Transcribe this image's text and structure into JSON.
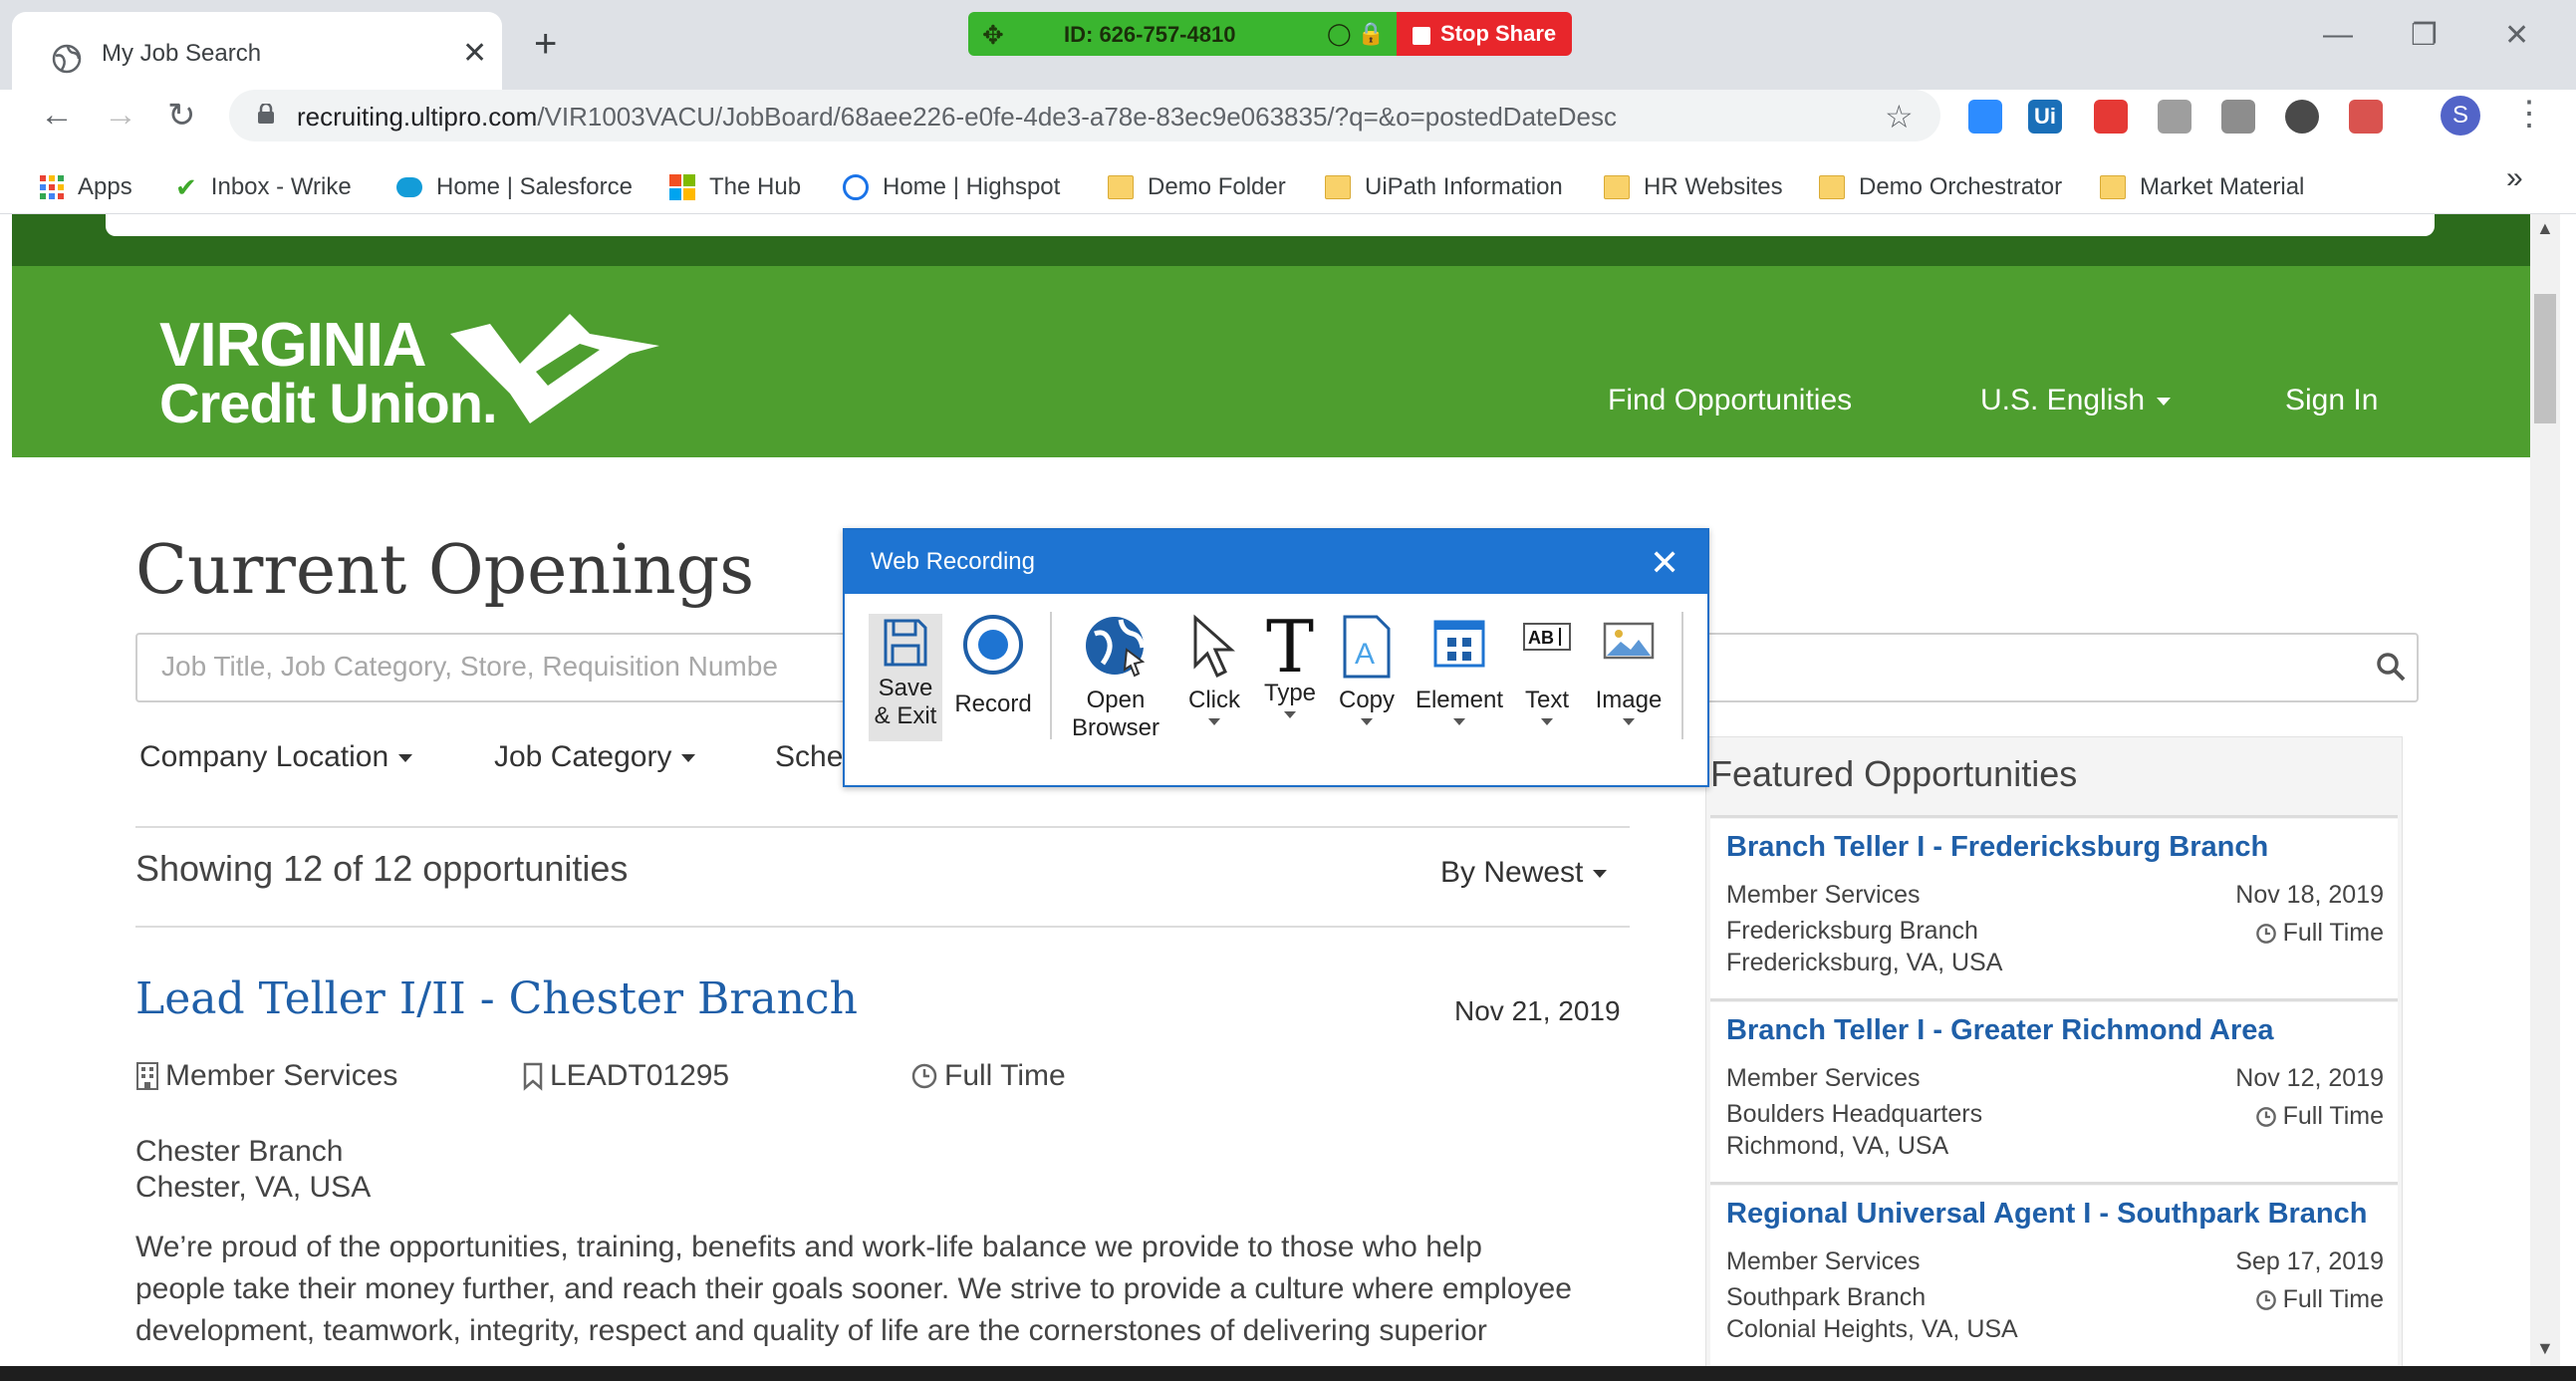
{
  "browser": {
    "tab_title": "My Job Search",
    "tab_close": "✕",
    "new_tab": "+",
    "url_domain": "recruiting.ultipro.com",
    "url_path": "/VIR1003VACU/JobBoard/68aee226-e0fe-4de3-a78e-83ec9e063835/?q=&o=postedDateDesc",
    "profile_initial": "S",
    "bookmarks": [
      {
        "label": "Apps"
      },
      {
        "label": "Inbox - Wrike"
      },
      {
        "label": "Home | Salesforce"
      },
      {
        "label": "The Hub"
      },
      {
        "label": "Home | Highspot"
      },
      {
        "label": "Demo Folder"
      },
      {
        "label": "UiPath Information"
      },
      {
        "label": "HR Websites"
      },
      {
        "label": "Demo Orchestrator"
      },
      {
        "label": "Market Material"
      }
    ],
    "bookmarks_more": "»"
  },
  "share": {
    "id_label": "ID: 626-757-4810",
    "stop_label": "Stop Share"
  },
  "site": {
    "logo_line1": "VIRGINIA",
    "logo_line2": "Credit Union.",
    "nav": {
      "find": "Find Opportunities",
      "language": "U.S. English",
      "sign_in": "Sign In"
    },
    "brand_green": "#4e9e2f"
  },
  "main": {
    "title": "Current Openings",
    "search_placeholder": "Job Title, Job Category, Store, Requisition Numbe",
    "filters": [
      "Company Location",
      "Job Category",
      "Sche"
    ],
    "showing": "Showing 12 of 12 opportunities",
    "sort_label": "By Newest",
    "job": {
      "title": "Lead Teller I/II - Chester Branch",
      "date": "Nov 21, 2019",
      "category": "Member Services",
      "requisition": "LEADT01295",
      "type": "Full Time",
      "location_line1": "Chester Branch",
      "location_line2": "Chester, VA, USA",
      "description_lines": [
        "We’re proud of the opportunities, training, benefits and work-life balance we provide to those who help",
        "people take their money further, and reach their goals sooner. We strive to provide a culture where employee",
        "development, teamwork, integrity, respect and quality of life are the cornerstones of delivering superior"
      ]
    }
  },
  "featured": {
    "heading": "Featured Opportunities",
    "items": [
      {
        "title": "Branch Teller I - Fredericksburg Branch",
        "category": "Member Services",
        "date": "Nov 18, 2019",
        "loc1": "Fredericksburg Branch",
        "loc2": "Fredericksburg, VA, USA",
        "type": "Full Time"
      },
      {
        "title": "Branch Teller I - Greater Richmond Area",
        "category": "Member Services",
        "date": "Nov 12, 2019",
        "loc1": "Boulders Headquarters",
        "loc2": "Richmond, VA, USA",
        "type": "Full Time"
      },
      {
        "title": "Regional Universal Agent I - Southpark Branch",
        "category": "Member Services",
        "date": "Sep 17, 2019",
        "loc1": "Southpark Branch",
        "loc2": "Colonial Heights, VA, USA",
        "type": "Full Time"
      }
    ]
  },
  "recorder": {
    "title": "Web Recording",
    "close": "✕",
    "save_line1": "Save",
    "save_line2": "& Exit",
    "record": "Record",
    "open_line1": "Open",
    "open_line2": "Browser",
    "click": "Click",
    "type": "Type",
    "copy": "Copy",
    "element": "Element",
    "text": "Text",
    "image": "Image"
  }
}
